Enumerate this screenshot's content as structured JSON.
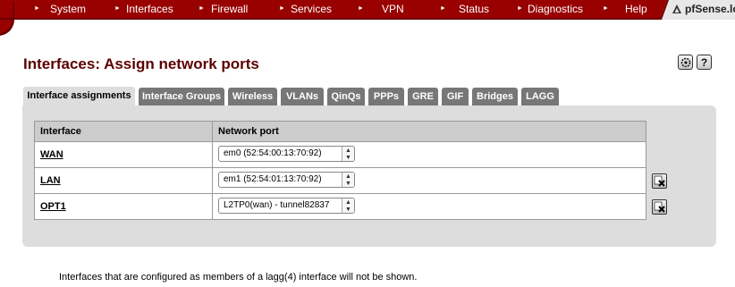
{
  "nav": {
    "items": [
      {
        "label": "System"
      },
      {
        "label": "Interfaces"
      },
      {
        "label": "Firewall"
      },
      {
        "label": "Services"
      },
      {
        "label": "VPN"
      },
      {
        "label": "Status"
      },
      {
        "label": "Diagnostics"
      },
      {
        "label": "Help"
      }
    ],
    "brand": "pfSense.lo",
    "color": "#990000"
  },
  "page": {
    "title": "Interfaces: Assign network ports",
    "icons": [
      "settings-icon",
      "help-icon"
    ],
    "help_glyph": "?"
  },
  "tabs": [
    {
      "label": "Interface assignments",
      "active": true
    },
    {
      "label": "Interface Groups"
    },
    {
      "label": "Wireless"
    },
    {
      "label": "VLANs"
    },
    {
      "label": "QinQs"
    },
    {
      "label": "PPPs"
    },
    {
      "label": "GRE"
    },
    {
      "label": "GIF"
    },
    {
      "label": "Bridges"
    },
    {
      "label": "LAGG"
    }
  ],
  "table": {
    "headers": [
      "Interface",
      "Network port"
    ],
    "rows": [
      {
        "interface": "WAN",
        "port": "em0 (52:54:00:13:70:92)",
        "deletable": false
      },
      {
        "interface": "LAN",
        "port": "em1 (52:54:01:13:70:92)",
        "deletable": true
      },
      {
        "interface": "OPT1",
        "port": "L2TP0(wan) - tunnel82837",
        "deletable": true
      }
    ]
  },
  "footnote": "Interfaces that are configured as members of a lagg(4) interface will not be shown."
}
